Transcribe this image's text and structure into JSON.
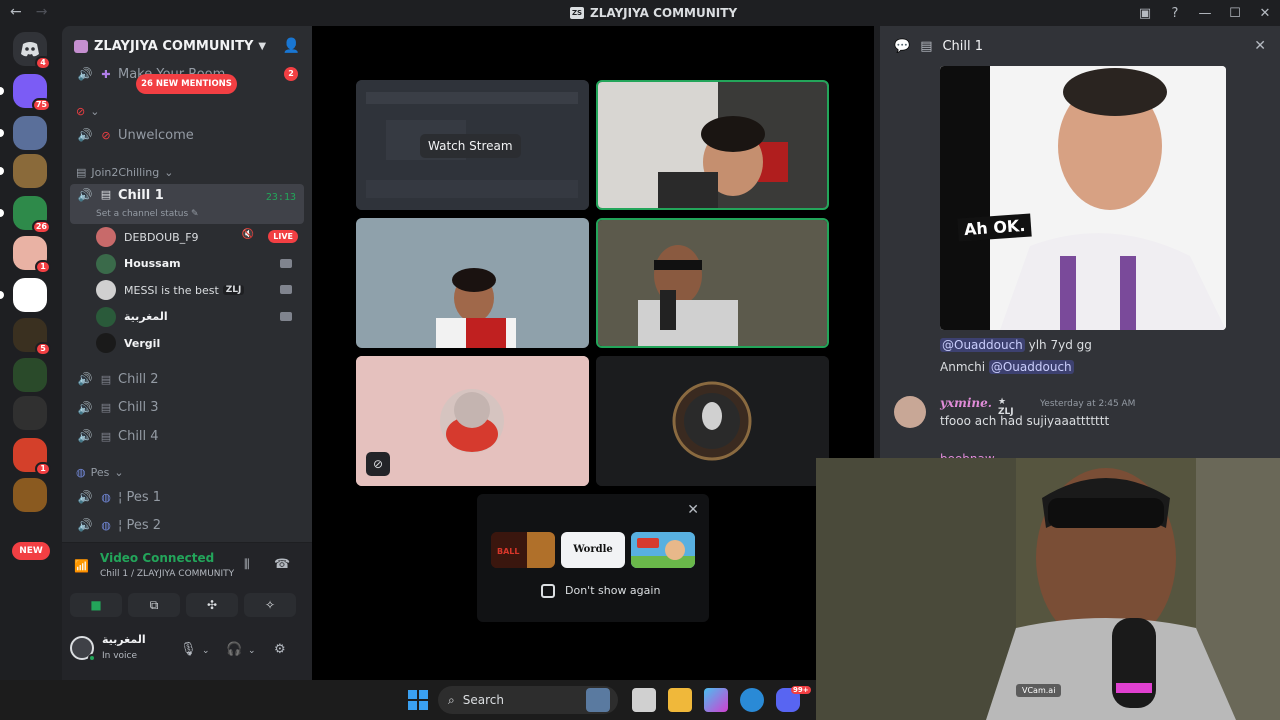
{
  "window": {
    "title": "ZLAYJIYA COMMUNITY",
    "back_icon": "←",
    "forward_icon": "→",
    "controls": [
      "▣",
      "?",
      "—",
      "☐",
      "✕"
    ]
  },
  "rail": {
    "home_badge": "4",
    "servers": [
      {
        "badge": "75",
        "color": "#7b5cf5"
      },
      {
        "badge": "",
        "color": "#5a6f9a"
      },
      {
        "badge": "",
        "color": "#8a6a3a"
      },
      {
        "badge": "26",
        "color": "#2e8a4a"
      },
      {
        "badge": "1",
        "color": "#e9b2a4"
      },
      {
        "badge": "",
        "color": "#ffffff"
      },
      {
        "badge": "5",
        "color": "#3a3020"
      },
      {
        "badge": "",
        "color": "#2a4a2a"
      },
      {
        "badge": "",
        "color": "#303030"
      },
      {
        "badge": "1",
        "color": "#d4402a"
      },
      {
        "badge": "",
        "color": "#8a5a20"
      }
    ],
    "new_label": "NEW"
  },
  "sidebar": {
    "server_name": "ZLAYJIYA COMMUNITY",
    "new_mentions": "26 NEW MENTIONS",
    "make_room": "Make Your Room",
    "make_room_count": "2",
    "channels_top": [
      {
        "label": "Unwelcome"
      }
    ],
    "categories": {
      "join": "Join2Chilling",
      "pes": "Pes"
    },
    "active_channel": {
      "label": "Chill 1",
      "time": "23:13",
      "status": "Set a channel status"
    },
    "voice_users": [
      {
        "name": "DEBDOUB_F9",
        "live": "LIVE",
        "bold": false,
        "tag": ""
      },
      {
        "name": "Houssam",
        "live": "",
        "bold": true,
        "tag": ""
      },
      {
        "name": "MESSI is the best",
        "live": "",
        "bold": false,
        "tag": "ZLJ"
      },
      {
        "name": "المغربية",
        "live": "",
        "bold": true,
        "tag": ""
      },
      {
        "name": "Vergil",
        "live": "",
        "bold": true,
        "tag": ""
      }
    ],
    "other_channels": [
      "Chill 2",
      "Chill 3",
      "Chill 4"
    ],
    "pes_channels": [
      "¦ Pes 1",
      "¦ Pes 2"
    ]
  },
  "voice_panel": {
    "status": "Video Connected",
    "location": "Chill 1 / ZLAYJIYA COMMUNITY"
  },
  "user": {
    "name": "المغربية",
    "status": "In voice"
  },
  "stage": {
    "watch_stream": "Watch Stream",
    "popup": {
      "wordle": "Wordle",
      "dont_show": "Don't show again"
    }
  },
  "chat": {
    "channel": "Chill 1",
    "image_caption": "Ah OK.",
    "line1_mention": "@Ouaddouch",
    "line1_text": " ylh 7yd gg",
    "line2_text": "Anmchi ",
    "line2_mention": "@Ouaddouch",
    "msg": {
      "author": "yxmine.",
      "tag": "ZLJ",
      "time": "Yesterday at 2:45 AM",
      "text": "tfooo ach had sujiyaaattttttt"
    },
    "next_author": "boobnaw"
  },
  "webcam": {
    "label": "VCam.ai"
  },
  "taskbar": {
    "search": "Search",
    "discord_badge": "99+"
  }
}
